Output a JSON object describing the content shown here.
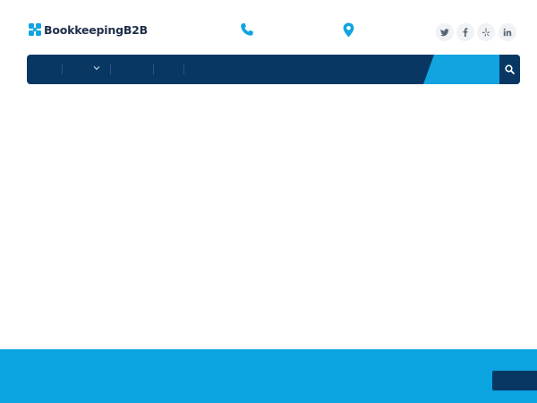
{
  "header": {
    "logo": {
      "text": "BookkeepingB2B",
      "icon": "logo-mark-icon"
    },
    "contact": {
      "phone_icon": "phone-icon",
      "location_icon": "map-pin-icon"
    },
    "social": [
      {
        "name": "twitter",
        "icon": "twitter-icon"
      },
      {
        "name": "facebook",
        "icon": "facebook-icon"
      },
      {
        "name": "yelp",
        "icon": "yelp-icon"
      },
      {
        "name": "linkedin",
        "icon": "linkedin-icon"
      }
    ]
  },
  "navbar": {
    "items": [
      {
        "label": ""
      },
      {
        "label": "",
        "has_dropdown": true
      },
      {
        "label": ""
      },
      {
        "label": ""
      }
    ],
    "cta_label": "",
    "search_icon": "search-icon"
  },
  "band": {
    "button_label": ""
  },
  "colors": {
    "navy": "#093764",
    "accent": "#11a4e0",
    "band": "#0ba3e0",
    "logo_text": "#1f2f4a",
    "social_bg": "#f0f2f5",
    "social_icon": "#5a6573"
  }
}
